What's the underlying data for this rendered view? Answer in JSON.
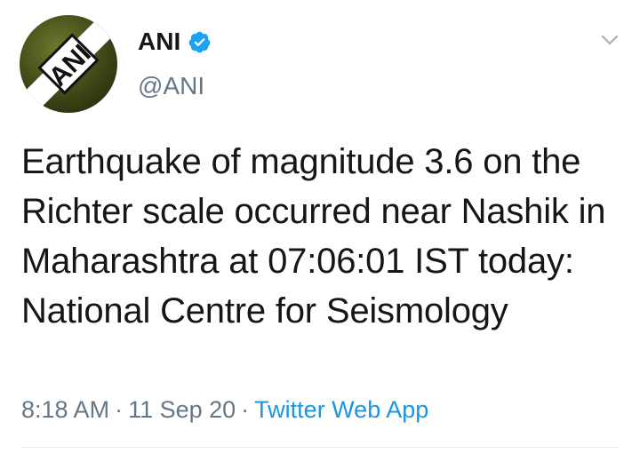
{
  "author": {
    "name": "ANI",
    "handle": "@ANI",
    "verified": true,
    "avatar_logo_text": "ANI"
  },
  "tweet": {
    "text": "Earthquake of magnitude 3.6 on the Richter scale occurred near Nashik in Maharashtra at 07:06:01 IST today: National Centre for Seismology",
    "time": "8:18 AM",
    "date": "11 Sep 20",
    "separator": "·",
    "source": "Twitter Web App"
  },
  "icons": {
    "verified": "verified-badge-icon",
    "menu": "chevron-down-icon"
  },
  "colors": {
    "verified_blue": "#1da1f2",
    "link_blue": "#1b95e0",
    "secondary_text": "#657786",
    "primary_text": "#14171a"
  }
}
